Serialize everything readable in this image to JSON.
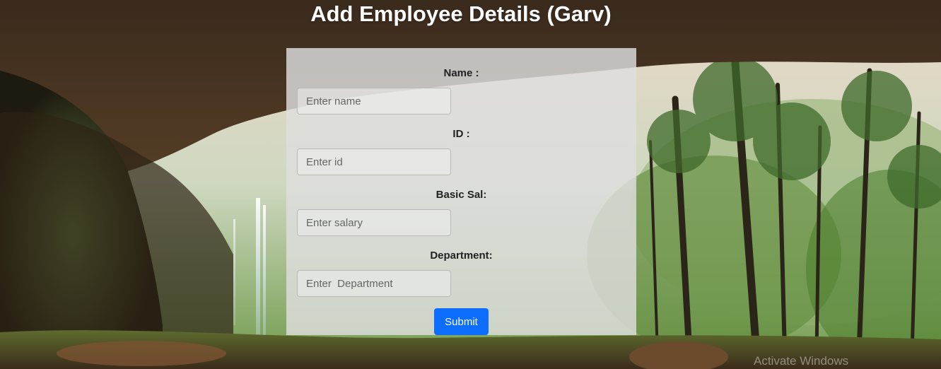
{
  "page": {
    "title": "Add Employee Details (Garv)"
  },
  "form": {
    "fields": [
      {
        "label": "Name :",
        "placeholder": "Enter name",
        "value": ""
      },
      {
        "label": "ID :",
        "placeholder": "Enter id",
        "value": ""
      },
      {
        "label": "Basic Sal:",
        "placeholder": "Enter salary",
        "value": ""
      },
      {
        "label": "Department:",
        "placeholder": "Enter  Department",
        "value": ""
      }
    ],
    "submit_label": "Submit"
  },
  "watermark": {
    "text": "Activate Windows"
  },
  "colors": {
    "submit_button": "#0d6efd",
    "form_card": "#dedede",
    "title_text": "#ffffff"
  }
}
